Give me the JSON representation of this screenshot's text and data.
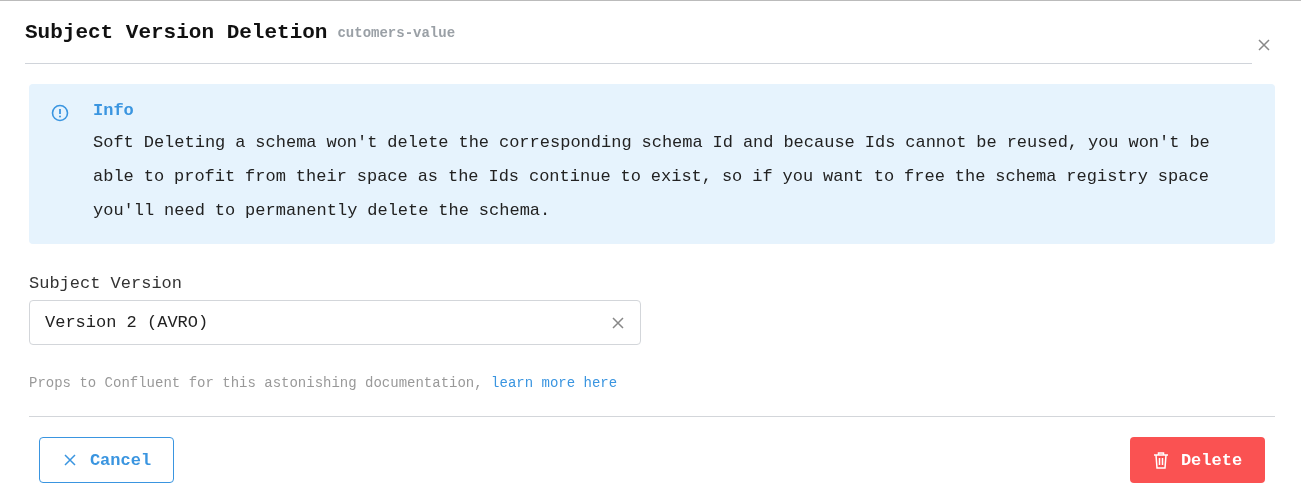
{
  "dialog": {
    "title": "Subject Version Deletion",
    "subtitle": "cutomers-value"
  },
  "alert": {
    "kind": "info",
    "title": "Info",
    "message": "Soft Deleting a schema won't delete the corresponding schema Id and because Ids cannot be reused, you won't be able to profit from their space as the Ids continue to exist, so if you want to free the schema registry space you'll need to permanently delete the schema."
  },
  "field": {
    "label": "Subject Version",
    "value": "Version 2 (AVRO)"
  },
  "help": {
    "text": "Props to Confluent for this astonishing documentation,",
    "link": "learn more here"
  },
  "buttons": [
    {
      "label": "Cancel",
      "kind": "secondary"
    },
    {
      "label": "Delete",
      "kind": "danger"
    }
  ]
}
